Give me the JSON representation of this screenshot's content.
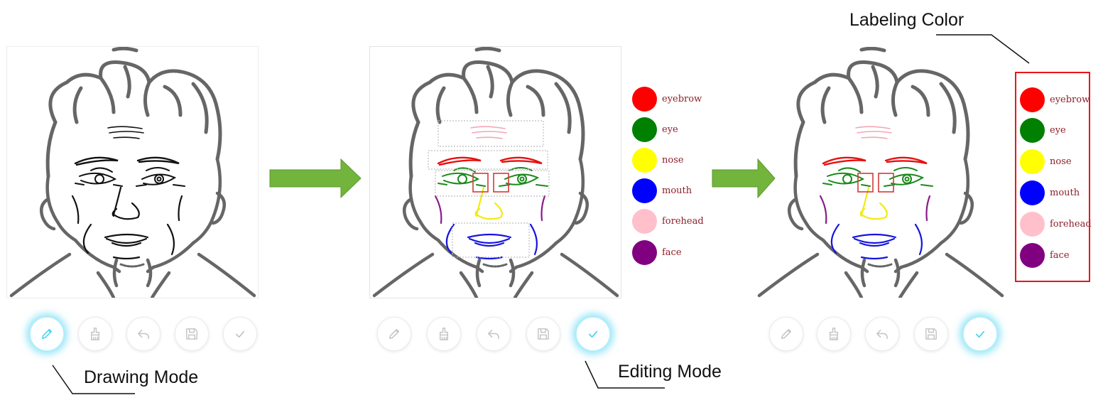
{
  "annotations": {
    "drawing_mode": "Drawing Mode",
    "editing_mode": "Editing Mode",
    "labeling_color": "Labeling Color"
  },
  "toolbar_icons": [
    "pencil-icon",
    "brush-icon",
    "undo-icon",
    "save-icon",
    "check-icon"
  ],
  "panels": [
    {
      "mode": "drawing",
      "active_tool": "pencil"
    },
    {
      "mode": "editing",
      "active_tool": "check"
    },
    {
      "mode": "labeling",
      "active_tool": "check"
    }
  ],
  "legend": {
    "items": [
      {
        "label": "eyebrow",
        "color": "#ff0000"
      },
      {
        "label": "eye",
        "color": "#008000"
      },
      {
        "label": "nose",
        "color": "#ffff00"
      },
      {
        "label": "mouth",
        "color": "#0000ff"
      },
      {
        "label": "forehead",
        "color": "#ffc0cb"
      },
      {
        "label": "face",
        "color": "#800080"
      }
    ]
  },
  "colors": {
    "flow_arrow": "#72b43c",
    "active_glow": "#46d2f0",
    "highlight_frame": "#e8161b",
    "legend_label": "#8c1f2b",
    "hair_outline": "#666666"
  }
}
